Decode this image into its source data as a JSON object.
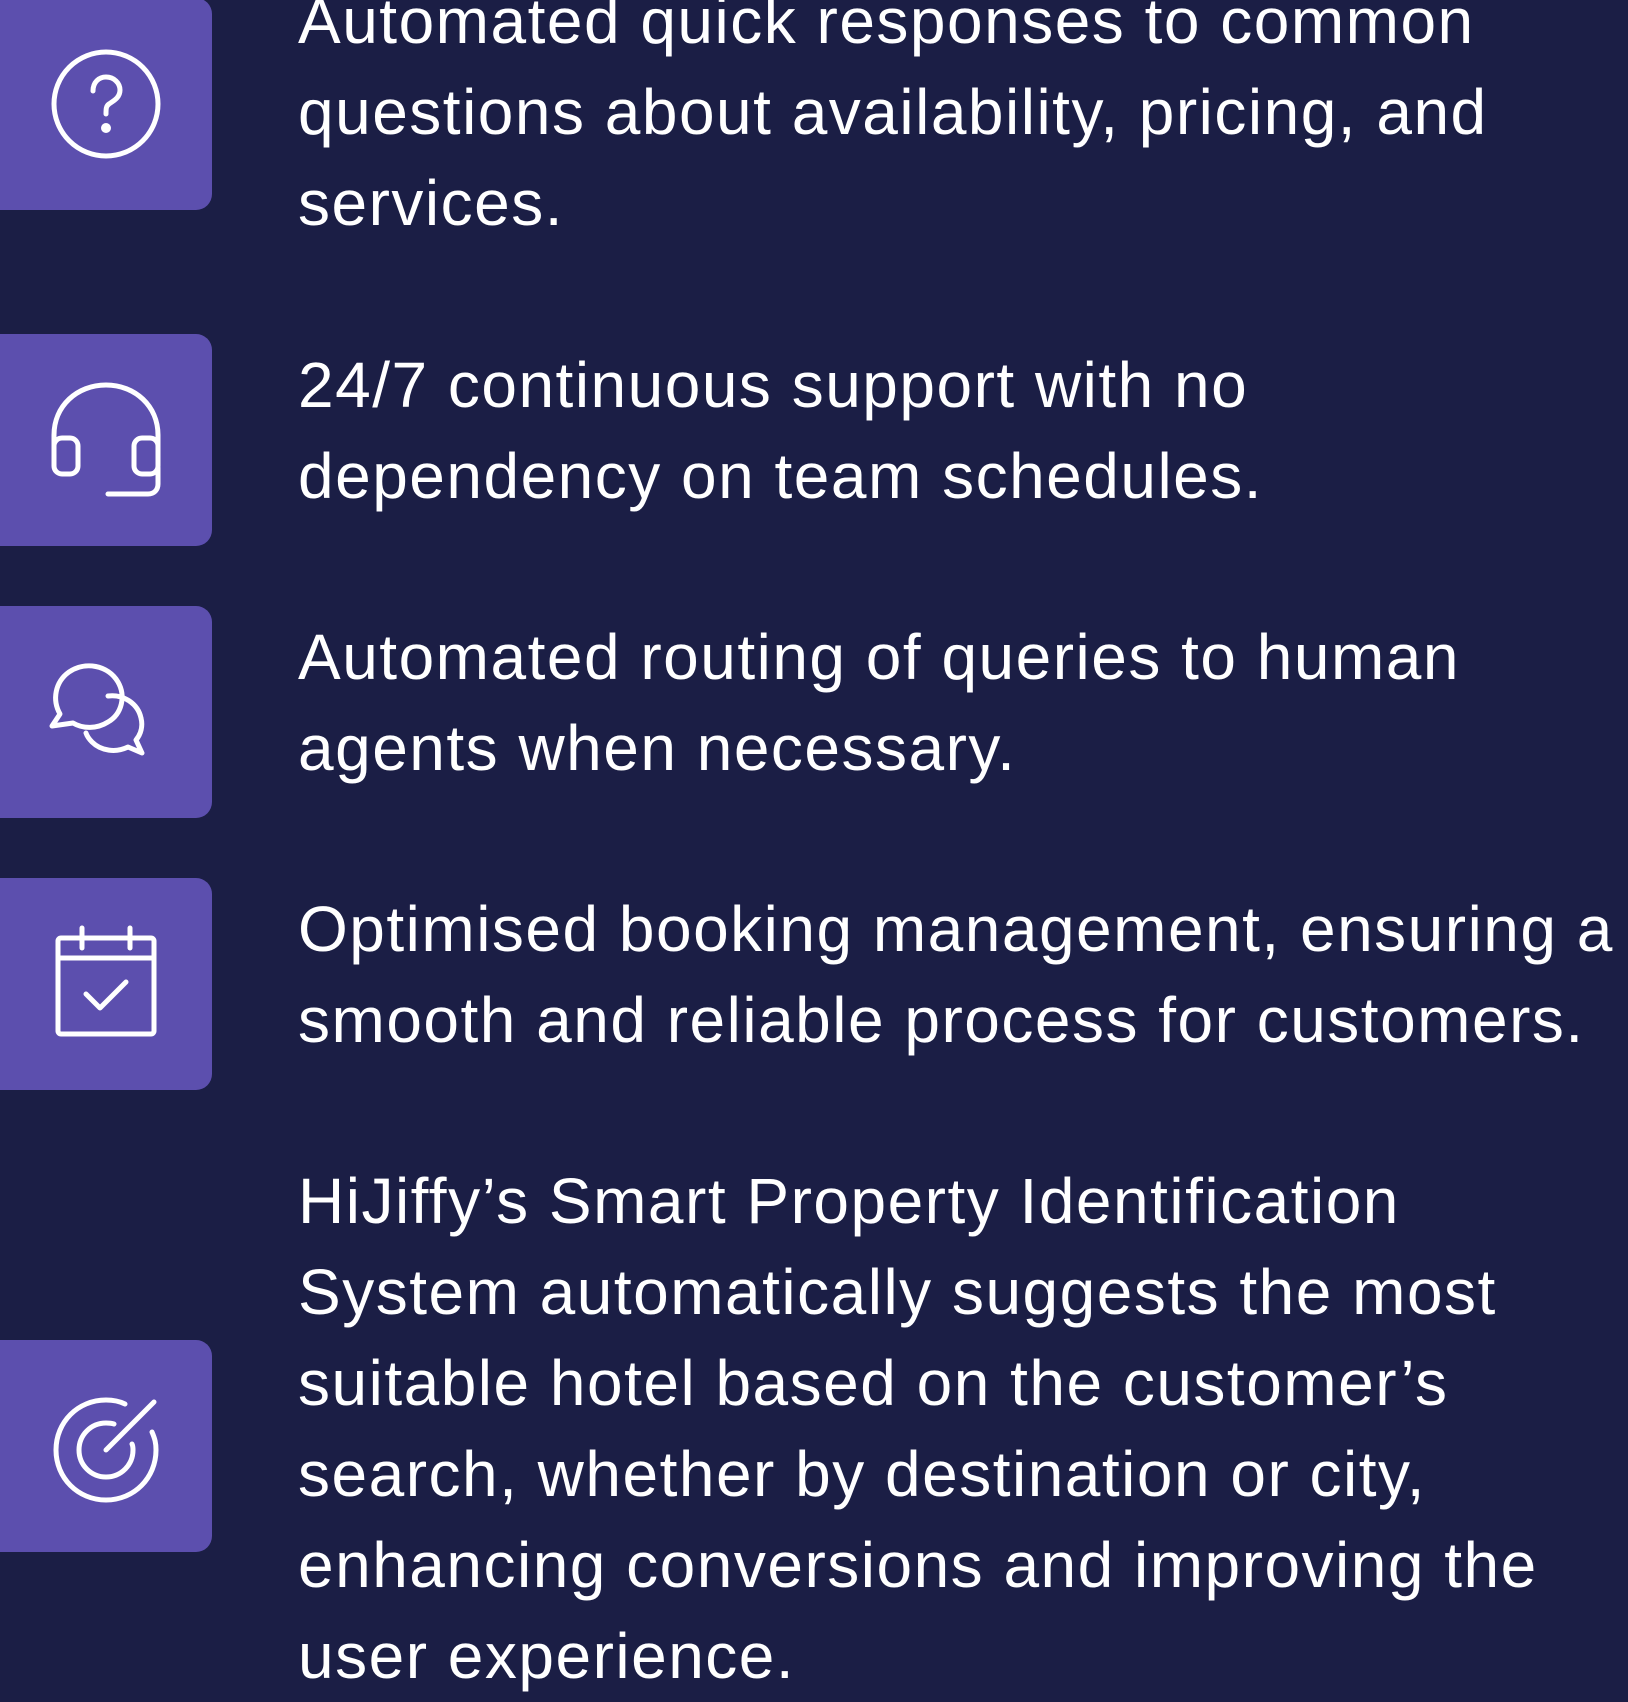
{
  "features": [
    {
      "icon": "question-circle-icon",
      "text": "Automated quick responses to common questions about availability, pricing, and services."
    },
    {
      "icon": "headset-icon",
      "text": "24/7 continuous support with no dependency on team schedules."
    },
    {
      "icon": "chat-bubbles-icon",
      "text": "Automated routing of queries to human agents when necessary."
    },
    {
      "icon": "calendar-check-icon",
      "text": "Optimised booking management, ensuring a smooth and reliable process for customers."
    },
    {
      "icon": "target-icon",
      "text": "HiJiffy’s Smart Property Identification System automatically suggests the most suitable hotel based on the customer’s search, whether by destination or city, enhancing conversions and improving the user experience."
    }
  ],
  "colors": {
    "background": "#1b1e45",
    "tile": "#5c4fae",
    "text": "#ffffff"
  }
}
